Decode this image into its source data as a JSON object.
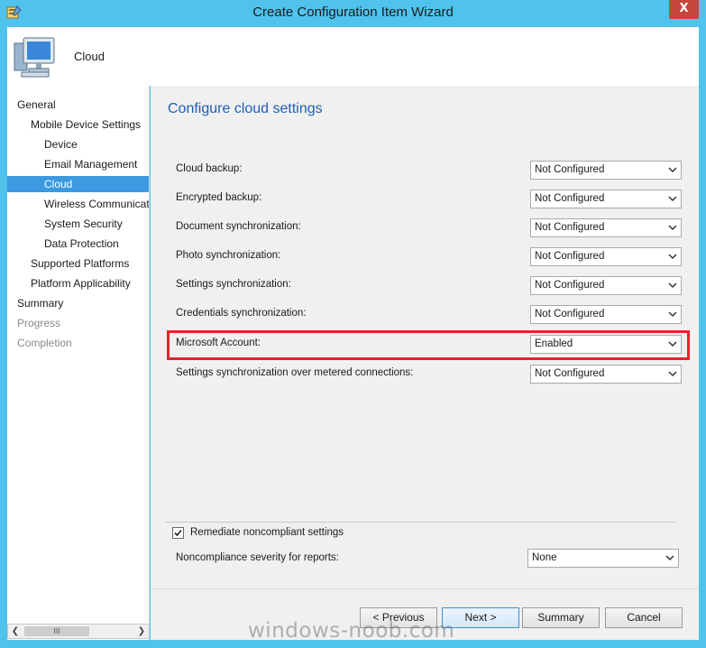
{
  "window": {
    "title": "Create Configuration Item Wizard",
    "close_glyph": "X"
  },
  "header": {
    "title": "Cloud"
  },
  "nav": {
    "items": [
      {
        "label": "General",
        "state": "normal"
      },
      {
        "label": "Mobile Device Settings",
        "state": "normal"
      },
      {
        "label": "Device",
        "state": "normal"
      },
      {
        "label": "Email Management",
        "state": "normal"
      },
      {
        "label": "Cloud",
        "state": "selected"
      },
      {
        "label": "Wireless Communications",
        "state": "normal"
      },
      {
        "label": "System Security",
        "state": "normal"
      },
      {
        "label": "Data Protection",
        "state": "normal"
      },
      {
        "label": "Supported Platforms",
        "state": "normal"
      },
      {
        "label": "Platform Applicability",
        "state": "normal"
      },
      {
        "label": "Summary",
        "state": "normal"
      },
      {
        "label": "Progress",
        "state": "disabled"
      },
      {
        "label": "Completion",
        "state": "disabled"
      }
    ],
    "scroll_thumb": "III"
  },
  "content": {
    "title": "Configure cloud settings",
    "settings": [
      {
        "label": "Cloud backup:",
        "value": "Not Configured"
      },
      {
        "label": "Encrypted backup:",
        "value": "Not Configured"
      },
      {
        "label": "Document synchronization:",
        "value": "Not Configured"
      },
      {
        "label": "Photo synchronization:",
        "value": "Not Configured"
      },
      {
        "label": "Settings synchronization:",
        "value": "Not Configured"
      },
      {
        "label": "Credentials synchronization:",
        "value": "Not Configured"
      },
      {
        "label": "Microsoft Account:",
        "value": "Enabled"
      },
      {
        "label": "Settings synchronization over metered connections:",
        "value": "Not Configured"
      }
    ],
    "remediate": {
      "label": "Remediate noncompliant settings",
      "checked": true
    },
    "severity": {
      "label": "Noncompliance severity for reports:",
      "value": "None"
    }
  },
  "buttons": {
    "previous": "< Previous",
    "next": "Next >",
    "summary": "Summary",
    "cancel": "Cancel"
  },
  "watermark": "windows-noob.com",
  "colors": {
    "accent": "#3b9ae0",
    "title_blue": "#1e5fb4",
    "highlight_red": "#e3242b",
    "chrome": "#4fc3ec"
  }
}
